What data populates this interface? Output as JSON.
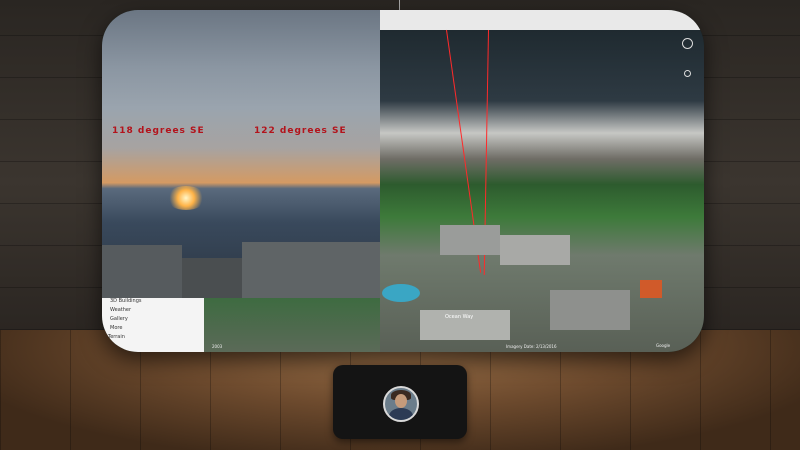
{
  "overlay": {
    "bearing_left": "118 degrees  SE",
    "bearing_right": "122 degrees  SE"
  },
  "layers_panel": {
    "items": [
      "3D Buildings",
      "Weather",
      "Gallery",
      "More",
      "Terrain"
    ]
  },
  "map": {
    "footer_left": "2003",
    "footer_center": "Imagery Date: 2/13/2016",
    "footer_right": "Google",
    "map_label": "Ocean Way"
  },
  "colors": {
    "ray": "#ff2a2a",
    "bearing_text": "#b3131b"
  },
  "icons": {
    "compass": "compass-icon",
    "zoom": "zoom-control-icon",
    "avatar": "user-avatar"
  }
}
